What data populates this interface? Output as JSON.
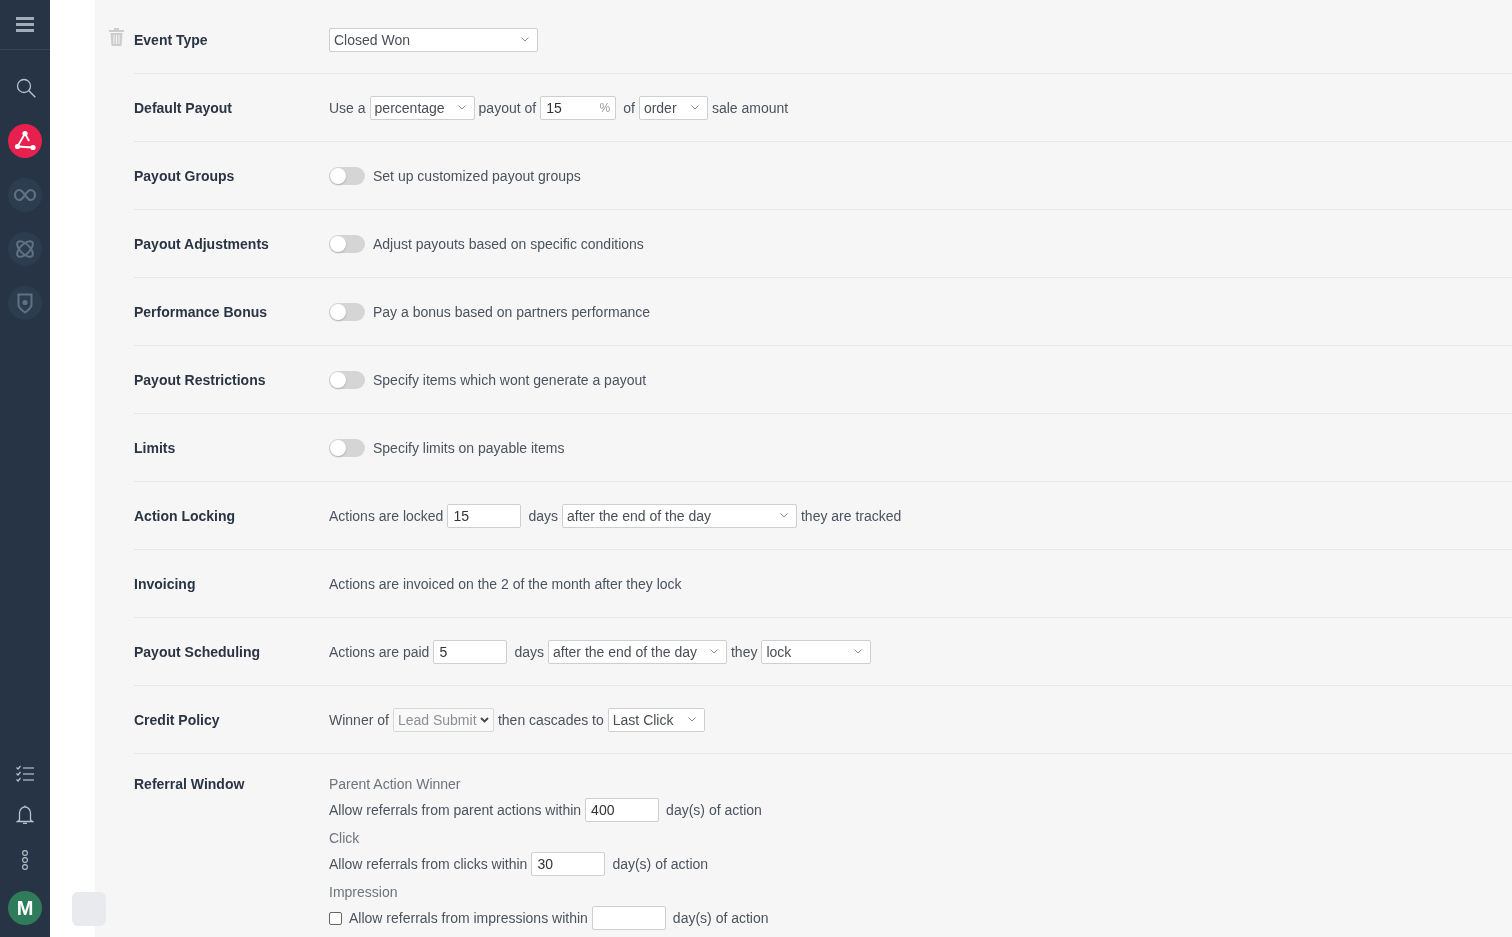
{
  "sidebar": {
    "nav_items": [
      {
        "selected": true
      },
      {
        "selected": false
      },
      {
        "selected": false
      },
      {
        "selected": false
      }
    ],
    "avatar": "M"
  },
  "settings": [
    {
      "label": "Event Type",
      "lines": [
        [
          {
            "kind": "select",
            "value": "Closed Won",
            "disabled": false
          }
        ]
      ]
    },
    {
      "label": "Default Payout",
      "lines": [
        [
          {
            "kind": "text",
            "text": "Use a"
          },
          {
            "kind": "select",
            "value": "percentage",
            "disabled": false
          },
          {
            "kind": "text",
            "text": "payout of"
          },
          {
            "kind": "input",
            "value": "15",
            "suffix": "%"
          },
          {
            "kind": "text",
            "text": "of"
          },
          {
            "kind": "select",
            "value": "order",
            "disabled": false
          },
          {
            "kind": "text",
            "text": "sale amount"
          }
        ]
      ]
    },
    {
      "label": "Payout Groups",
      "lines": [
        [
          {
            "kind": "toggle",
            "on": false
          },
          {
            "kind": "text",
            "text": "Set up customized payout groups"
          }
        ]
      ]
    },
    {
      "label": "Payout Adjustments",
      "lines": [
        [
          {
            "kind": "toggle",
            "on": false
          },
          {
            "kind": "text",
            "text": "Adjust payouts based on specific conditions"
          }
        ]
      ]
    },
    {
      "label": "Performance Bonus",
      "lines": [
        [
          {
            "kind": "toggle",
            "on": false
          },
          {
            "kind": "text",
            "text": "Pay a bonus based on partners performance"
          }
        ]
      ]
    },
    {
      "label": "Payout Restrictions",
      "lines": [
        [
          {
            "kind": "toggle",
            "on": false
          },
          {
            "kind": "text",
            "text": "Specify items which wont generate a payout"
          }
        ]
      ]
    },
    {
      "label": "Limits",
      "lines": [
        [
          {
            "kind": "toggle",
            "on": false
          },
          {
            "kind": "text",
            "text": "Specify limits on payable items"
          }
        ]
      ]
    },
    {
      "label": "Action Locking",
      "lines": [
        [
          {
            "kind": "text",
            "text": "Actions are locked"
          },
          {
            "kind": "input",
            "value": "15"
          },
          {
            "kind": "text",
            "text": "days"
          },
          {
            "kind": "select",
            "value": "after the end of the day",
            "disabled": false
          },
          {
            "kind": "text",
            "text": "they are tracked"
          }
        ]
      ]
    },
    {
      "label": "Invoicing",
      "lines": [
        [
          {
            "kind": "text",
            "text": "Actions are invoiced on the 2 of the month after they lock"
          }
        ]
      ]
    },
    {
      "label": "Payout Scheduling",
      "lines": [
        [
          {
            "kind": "text",
            "text": "Actions are paid"
          },
          {
            "kind": "input",
            "value": "5"
          },
          {
            "kind": "text",
            "text": "days"
          },
          {
            "kind": "select",
            "value": "after the end of the day",
            "disabled": false
          },
          {
            "kind": "text",
            "text": "they"
          },
          {
            "kind": "select",
            "value": "lock",
            "disabled": false
          }
        ]
      ]
    },
    {
      "label": "Credit Policy",
      "lines": [
        [
          {
            "kind": "text",
            "text": "Winner of"
          },
          {
            "kind": "select",
            "value": "Lead Submit",
            "disabled": true
          },
          {
            "kind": "text",
            "text": "then cascades to"
          },
          {
            "kind": "select",
            "value": "Last Click",
            "disabled": false
          }
        ]
      ]
    },
    {
      "label": "Referral Window",
      "lines": [
        [
          {
            "kind": "note",
            "text": "Parent Action Winner"
          }
        ],
        [
          {
            "kind": "text",
            "text": "Allow referrals from parent actions within"
          },
          {
            "kind": "input",
            "value": "400"
          },
          {
            "kind": "text",
            "text": "day(s) of action"
          }
        ],
        [
          {
            "kind": "note",
            "text": "Click"
          }
        ],
        [
          {
            "kind": "text",
            "text": "Allow referrals from clicks within"
          },
          {
            "kind": "input",
            "value": "30"
          },
          {
            "kind": "text",
            "text": "day(s) of action"
          }
        ],
        [
          {
            "kind": "note",
            "text": "Impression"
          }
        ],
        [
          {
            "kind": "checkbox",
            "checked": false
          },
          {
            "kind": "text",
            "text": "Allow referrals from impressions within"
          },
          {
            "kind": "input"
          },
          {
            "kind": "text",
            "text": "day(s) of action"
          }
        ]
      ]
    }
  ]
}
